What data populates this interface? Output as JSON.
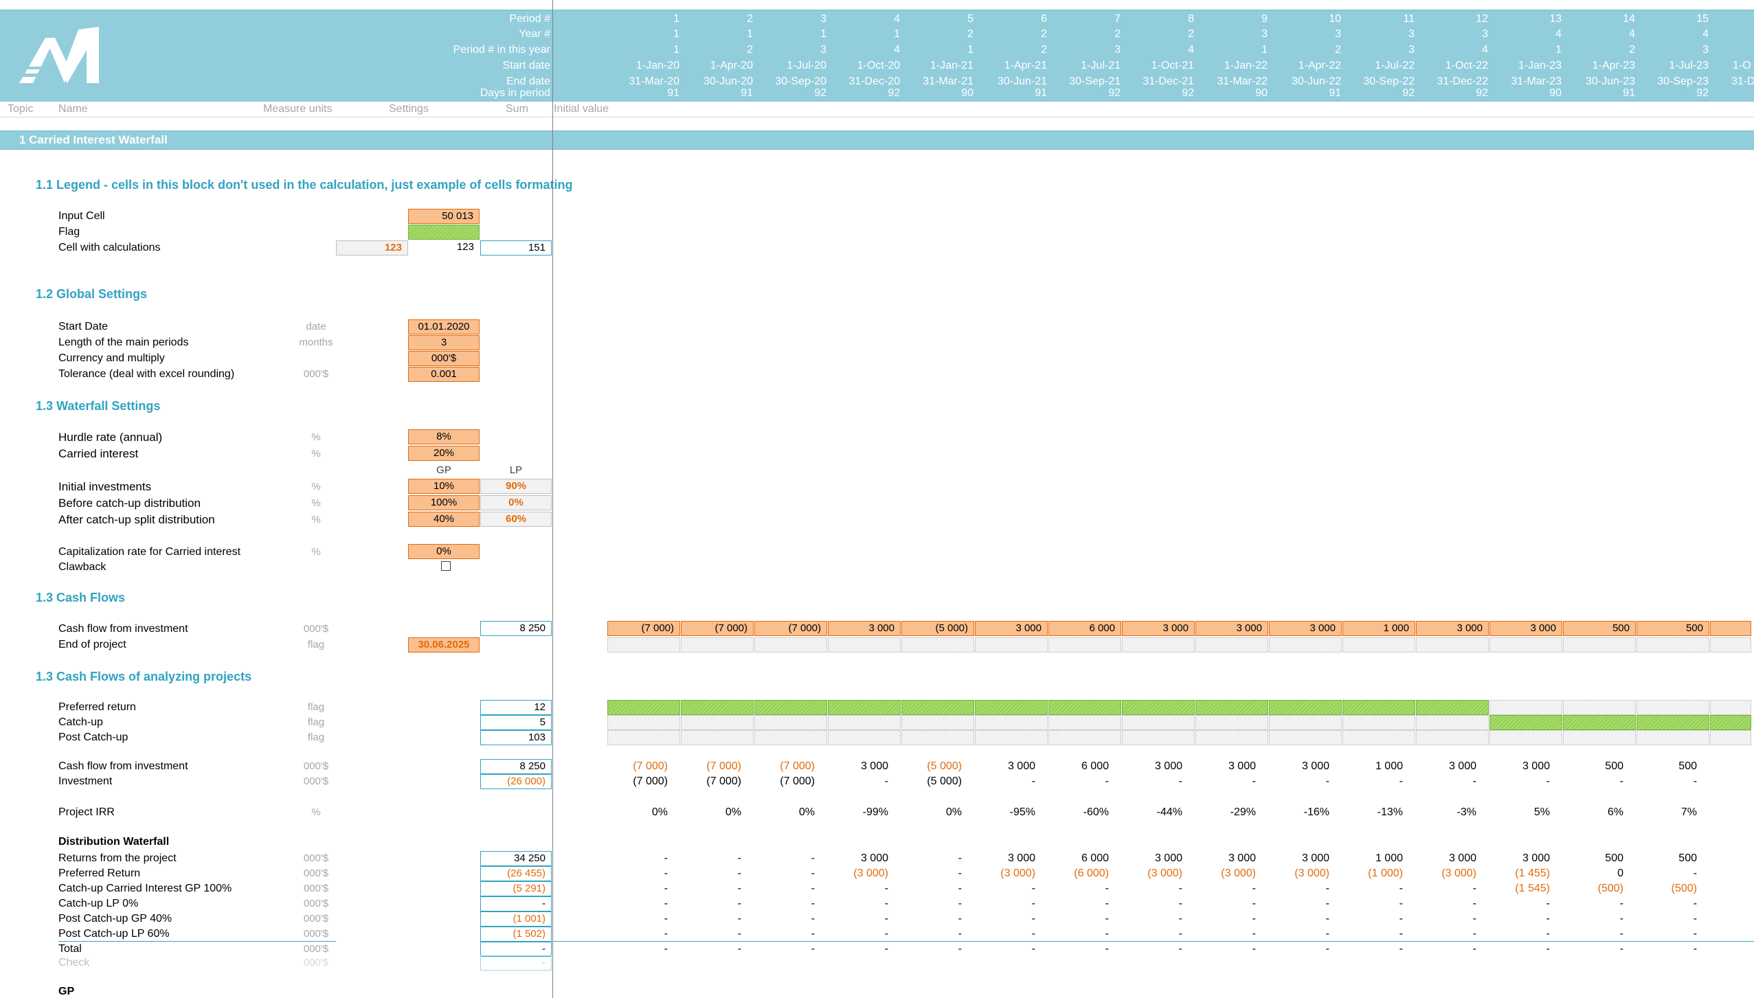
{
  "logo": "M",
  "header": {
    "labels": [
      "Period #",
      "Year #",
      "Period # in this year",
      "Start date",
      "End date",
      "Days in period"
    ],
    "period": [
      "1",
      "2",
      "3",
      "4",
      "5",
      "6",
      "7",
      "8",
      "9",
      "10",
      "11",
      "12",
      "13",
      "14",
      "15"
    ],
    "year": [
      "1",
      "1",
      "1",
      "1",
      "2",
      "2",
      "2",
      "2",
      "3",
      "3",
      "3",
      "3",
      "4",
      "4",
      "4"
    ],
    "pinyear": [
      "1",
      "2",
      "3",
      "4",
      "1",
      "2",
      "3",
      "4",
      "1",
      "2",
      "3",
      "4",
      "1",
      "2",
      "3"
    ],
    "start": [
      "1-Jan-20",
      "1-Apr-20",
      "1-Jul-20",
      "1-Oct-20",
      "1-Jan-21",
      "1-Apr-21",
      "1-Jul-21",
      "1-Oct-21",
      "1-Jan-22",
      "1-Apr-22",
      "1-Jul-22",
      "1-Oct-22",
      "1-Jan-23",
      "1-Apr-23",
      "1-Jul-23"
    ],
    "end": [
      "31-Mar-20",
      "30-Jun-20",
      "30-Sep-20",
      "31-Dec-20",
      "31-Mar-21",
      "30-Jun-21",
      "30-Sep-21",
      "31-Dec-21",
      "31-Mar-22",
      "30-Jun-22",
      "30-Sep-22",
      "31-Dec-22",
      "31-Mar-23",
      "30-Jun-23",
      "30-Sep-23"
    ],
    "days": [
      "91",
      "91",
      "92",
      "92",
      "90",
      "91",
      "92",
      "92",
      "90",
      "91",
      "92",
      "92",
      "90",
      "91",
      "92"
    ],
    "next_start": "1-O",
    "next_end": "31-D"
  },
  "columns": {
    "topic": "Topic",
    "name": "Name",
    "units": "Measure units",
    "settings": "Settings",
    "sum": "Sum",
    "initial": "Initial value"
  },
  "section_title": "1 Carried Interest Waterfall",
  "legend": {
    "title": "1.1 Legend - cells in this block don't used in the calculation, just example of cells formating",
    "input_label": "Input Cell",
    "input_value": "50 013",
    "flag_label": "Flag",
    "calc_label": "Cell with calculations",
    "calc_a": "123",
    "calc_b": "123",
    "calc_c": "151"
  },
  "global": {
    "title": "1.2 Global Settings",
    "rows": [
      {
        "label": "Start Date",
        "unit": "date",
        "value": "01.01.2020"
      },
      {
        "label": "Length of the main periods",
        "unit": "months",
        "value": "3"
      },
      {
        "label": "Currency and multiply",
        "unit": "",
        "value": "000'$"
      },
      {
        "label": "Tolerance (deal with excel rounding)",
        "unit": "000'$",
        "value": "0.001"
      }
    ]
  },
  "waterfall": {
    "title": "1.3 Waterfall Settings",
    "hurdle_label": "Hurdle rate (annual)",
    "hurdle_unit": "%",
    "hurdle": "8%",
    "carried_label": "Carried interest",
    "carried_unit": "%",
    "carried": "20%",
    "gp_hdr": "GP",
    "lp_hdr": "LP",
    "rows": [
      {
        "label": "Initial investments",
        "unit": "%",
        "gp": "10%",
        "lp": "90%"
      },
      {
        "label": "Before catch-up distribution",
        "unit": "%",
        "gp": "100%",
        "lp": "0%"
      },
      {
        "label": "After catch-up split distribution",
        "unit": "%",
        "gp": "40%",
        "lp": "60%"
      }
    ],
    "cap_label": "Capitalization rate for Carried interest",
    "cap_unit": "%",
    "cap": "0%",
    "clawback_label": "Clawback"
  },
  "cashflows": {
    "title": "1.3 Cash Flows",
    "cf_label": "Cash flow from investment",
    "cf_unit": "000'$",
    "cf_sum": "8 250",
    "cf_values": [
      "(7 000)",
      "(7 000)",
      "(7 000)",
      "3 000",
      "(5 000)",
      "3 000",
      "6 000",
      "3 000",
      "3 000",
      "3 000",
      "1 000",
      "3 000",
      "3 000",
      "500",
      "500"
    ],
    "end_label": "End of project",
    "end_unit": "flag",
    "end_value": "30.06.2025"
  },
  "analyzing": {
    "title": "1.3 Cash Flows of analyzing projects",
    "flags": [
      {
        "label": "Preferred return",
        "unit": "flag",
        "sum": "12"
      },
      {
        "label": "Catch-up",
        "unit": "flag",
        "sum": "5"
      },
      {
        "label": "Post Catch-up",
        "unit": "flag",
        "sum": "103"
      }
    ],
    "cf_label": "Cash flow from investment",
    "cf_unit": "000'$",
    "cf_sum": "8 250",
    "cf_values": [
      "(7 000)",
      "(7 000)",
      "(7 000)",
      "3 000",
      "(5 000)",
      "3 000",
      "6 000",
      "3 000",
      "3 000",
      "3 000",
      "1 000",
      "3 000",
      "3 000",
      "500",
      "500"
    ],
    "inv_label": "Investment",
    "inv_unit": "000'$",
    "inv_sum": "(26 000)",
    "inv_values": [
      "(7 000)",
      "(7 000)",
      "(7 000)",
      "-",
      "(5 000)",
      "-",
      "-",
      "-",
      "-",
      "-",
      "-",
      "-",
      "-",
      "-",
      "-"
    ],
    "irr_label": "Project IRR",
    "irr_unit": "%",
    "irr_values": [
      "0%",
      "0%",
      "0%",
      "-99%",
      "0%",
      "-95%",
      "-60%",
      "-44%",
      "-29%",
      "-16%",
      "-13%",
      "-3%",
      "5%",
      "6%",
      "7%"
    ]
  },
  "distribution": {
    "title": "Distribution Waterfall",
    "rows": [
      {
        "label": "Returns from the project",
        "unit": "000'$",
        "sum": "34 250",
        "sum_orange": false,
        "values": [
          "-",
          "-",
          "-",
          "3 000",
          "-",
          "3 000",
          "6 000",
          "3 000",
          "3 000",
          "3 000",
          "1 000",
          "3 000",
          "3 000",
          "500",
          "500"
        ]
      },
      {
        "label": "Preferred Return",
        "unit": "000'$",
        "sum": "(26 455)",
        "sum_orange": true,
        "values": [
          "-",
          "-",
          "-",
          "(3 000)",
          "-",
          "(3 000)",
          "(6 000)",
          "(3 000)",
          "(3 000)",
          "(3 000)",
          "(1 000)",
          "(3 000)",
          "(1 455)",
          "0",
          "-"
        ]
      },
      {
        "label": "Catch-up Carried Interest GP 100%",
        "unit": "000'$",
        "sum": "(5 291)",
        "sum_orange": true,
        "values": [
          "-",
          "-",
          "-",
          "-",
          "-",
          "-",
          "-",
          "-",
          "-",
          "-",
          "-",
          "-",
          "(1 545)",
          "(500)",
          "(500)"
        ]
      },
      {
        "label": "Catch-up LP 0%",
        "unit": "000'$",
        "sum": "-",
        "sum_orange": false,
        "values": [
          "-",
          "-",
          "-",
          "-",
          "-",
          "-",
          "-",
          "-",
          "-",
          "-",
          "-",
          "-",
          "-",
          "-",
          "-"
        ]
      },
      {
        "label": "Post Catch-up GP 40%",
        "unit": "000'$",
        "sum": "(1 001)",
        "sum_orange": true,
        "values": [
          "-",
          "-",
          "-",
          "-",
          "-",
          "-",
          "-",
          "-",
          "-",
          "-",
          "-",
          "-",
          "-",
          "-",
          "-"
        ]
      },
      {
        "label": "Post Catch-up LP 60%",
        "unit": "000'$",
        "sum": "(1 502)",
        "sum_orange": true,
        "values": [
          "-",
          "-",
          "-",
          "-",
          "-",
          "-",
          "-",
          "-",
          "-",
          "-",
          "-",
          "-",
          "-",
          "-",
          "-"
        ]
      },
      {
        "label": "Total",
        "unit": "000'$",
        "sum": "-",
        "sum_orange": false,
        "values": [
          "-",
          "-",
          "-",
          "-",
          "-",
          "-",
          "-",
          "-",
          "-",
          "-",
          "-",
          "-",
          "-",
          "-",
          "-"
        ]
      }
    ],
    "check_label": "Check",
    "check_unit": "000'$",
    "check_sum": "-"
  },
  "gp_title": "GP",
  "colors": {
    "header": "#92cddc",
    "accent": "#31a3c0",
    "input": "#fabf8f",
    "flag": "#92d050",
    "orange": "#e26b0a"
  }
}
